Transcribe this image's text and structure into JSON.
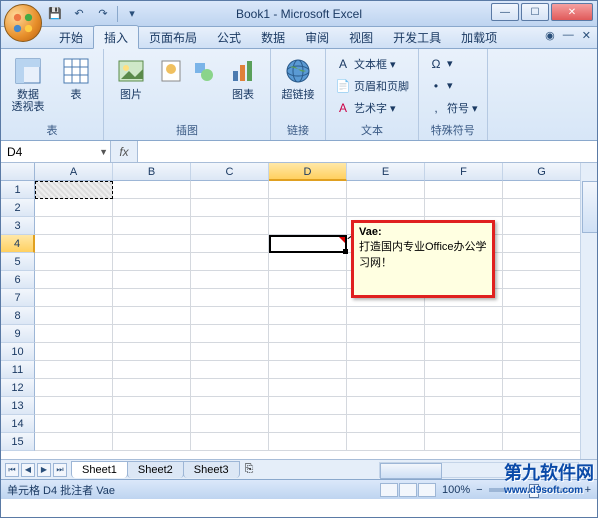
{
  "title": "Book1 - Microsoft Excel",
  "qat": {
    "save": "💾",
    "undo": "↶",
    "redo": "↷"
  },
  "tabs": {
    "items": [
      "开始",
      "插入",
      "页面布局",
      "公式",
      "数据",
      "审阅",
      "视图",
      "开发工具",
      "加载项"
    ],
    "active_index": 1
  },
  "ribbon": {
    "groups": [
      {
        "label": "表",
        "buttons": [
          {
            "icon": "pivot",
            "label": "数据\n透视表"
          },
          {
            "icon": "table",
            "label": "表"
          }
        ]
      },
      {
        "label": "插图",
        "buttons": [
          {
            "icon": "pic",
            "label": "图片"
          },
          {
            "icon": "gallery",
            "label": ""
          },
          {
            "icon": "gallery2",
            "label": ""
          },
          {
            "icon": "chart",
            "label": "图表"
          }
        ]
      },
      {
        "label": "链接",
        "buttons": [
          {
            "icon": "link",
            "label": "超链接"
          }
        ]
      },
      {
        "label": "文本",
        "small": [
          {
            "icon": "A",
            "label": "文本框 ▾"
          },
          {
            "icon": "📄",
            "label": "页眉和页脚"
          },
          {
            "icon": "🅰",
            "label": "艺术字 ▾"
          }
        ]
      },
      {
        "label": "特殊符号",
        "small": [
          {
            "icon": "Ω",
            "label": "▾"
          },
          {
            "icon": "•",
            "label": "▾"
          },
          {
            "icon": ",",
            "label": "符号 ▾"
          }
        ]
      }
    ]
  },
  "namebox": "D4",
  "fx_label": "fx",
  "columns": [
    "A",
    "B",
    "C",
    "D",
    "E",
    "F",
    "G"
  ],
  "rows": [
    "1",
    "2",
    "3",
    "4",
    "5",
    "6",
    "7",
    "8",
    "9",
    "10",
    "11",
    "12",
    "13",
    "14",
    "15"
  ],
  "selected": {
    "col": "D",
    "row": "4"
  },
  "comment": {
    "author": "Vae:",
    "text": "打造国内专业Office办公学习网！"
  },
  "sheets": {
    "items": [
      "Sheet1",
      "Sheet2",
      "Sheet3"
    ],
    "active_index": 0
  },
  "status": {
    "left": "单元格 D4 批注者 Vae",
    "zoom": "100%"
  },
  "zoom_btns": {
    "minus": "−",
    "plus": "+"
  },
  "watermark": {
    "main": "第九软件网",
    "sub": "www.d9soft.com"
  }
}
